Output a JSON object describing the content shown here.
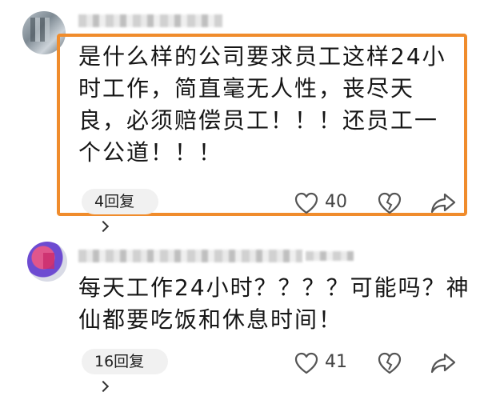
{
  "comments": [
    {
      "text": "是什么样的公司要求员工这样24小时工作，简直毫无人性，丧尽天良，必须赔偿员工！！！还员工一个公道！！！",
      "reply_label": "4回复",
      "likes": "40"
    },
    {
      "text": "每天工作24小时？？？？可能吗？神仙都要吃饭和休息时间！",
      "reply_label": "16回复",
      "likes": "41"
    }
  ],
  "colors": {
    "highlight": "#f08c2c",
    "reply_bg": "#f1f1f1"
  },
  "icons": [
    "heart-icon",
    "broken-heart-icon",
    "share-icon",
    "chevron-right-icon"
  ]
}
